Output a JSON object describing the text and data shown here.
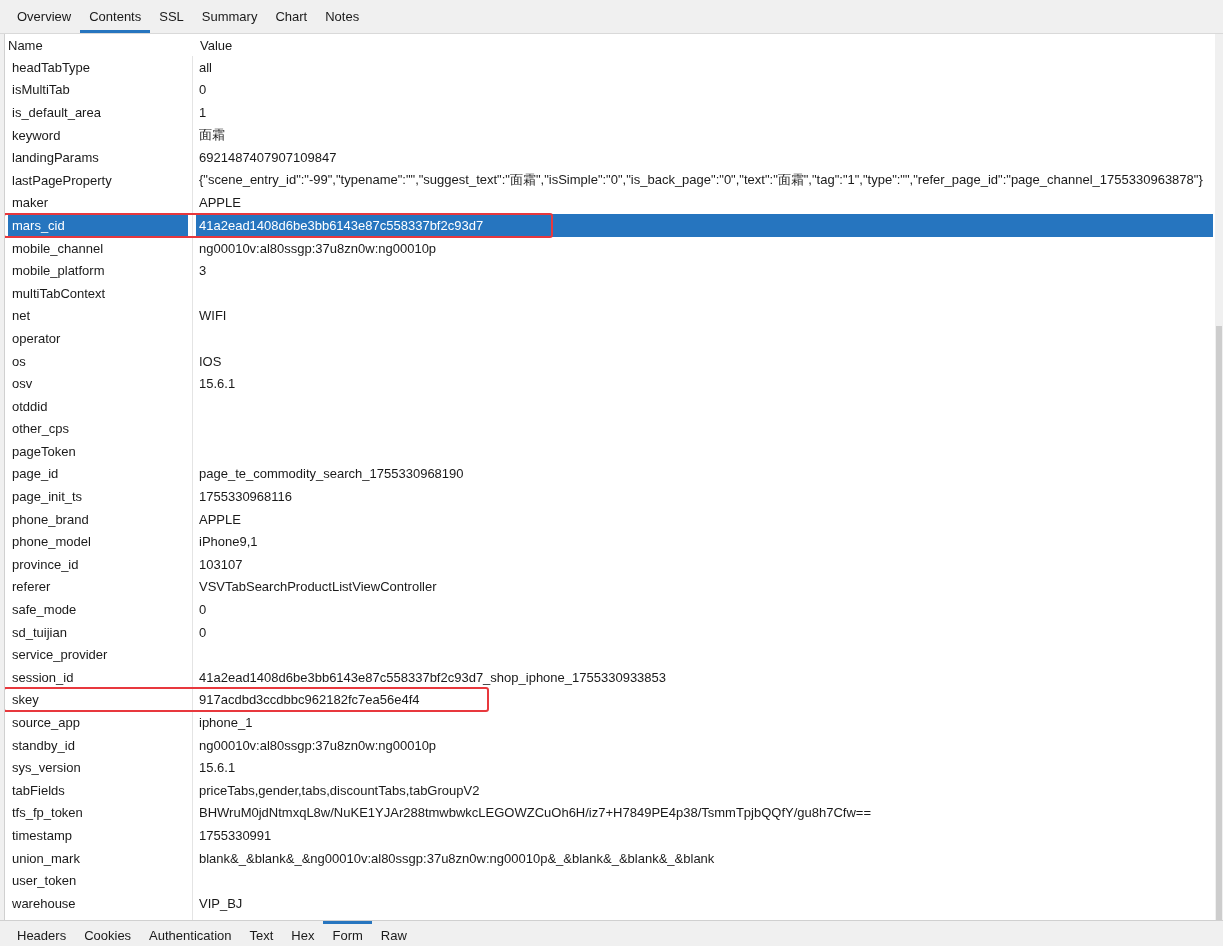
{
  "tabs": [
    {
      "label": "Overview",
      "selected": false
    },
    {
      "label": "Contents",
      "selected": true
    },
    {
      "label": "SSL",
      "selected": false
    },
    {
      "label": "Summary",
      "selected": false
    },
    {
      "label": "Chart",
      "selected": false
    },
    {
      "label": "Notes",
      "selected": false
    }
  ],
  "table": {
    "columns": [
      "Name",
      "Value"
    ],
    "rows": [
      {
        "name": "headTabType",
        "value": "all",
        "selected": false,
        "highlighted": false
      },
      {
        "name": "isMultiTab",
        "value": "0",
        "selected": false,
        "highlighted": false
      },
      {
        "name": "is_default_area",
        "value": "1",
        "selected": false,
        "highlighted": false
      },
      {
        "name": "keyword",
        "value": "面霜",
        "selected": false,
        "highlighted": false
      },
      {
        "name": "landingParams",
        "value": "6921487407907109847",
        "selected": false,
        "highlighted": false
      },
      {
        "name": "lastPageProperty",
        "value": "{\"scene_entry_id\":\"-99\",\"typename\":\"\",\"suggest_text\":\"面霜\",\"isSimple\":\"0\",\"is_back_page\":\"0\",\"text\":\"面霜\",\"tag\":\"1\",\"type\":\"\",\"refer_page_id\":\"page_channel_1755330963878\"}",
        "selected": false,
        "highlighted": false
      },
      {
        "name": "maker",
        "value": "APPLE",
        "selected": false,
        "highlighted": false
      },
      {
        "name": "mars_cid",
        "value": "41a2ead1408d6be3bb6143e87c558337bf2c93d7",
        "selected": true,
        "highlighted": true
      },
      {
        "name": "mobile_channel",
        "value": "ng00010v:al80ssgp:37u8zn0w:ng00010p",
        "selected": false,
        "highlighted": false
      },
      {
        "name": "mobile_platform",
        "value": "3",
        "selected": false,
        "highlighted": false
      },
      {
        "name": "multiTabContext",
        "selected": false,
        "highlighted": false
      },
      {
        "name": "net",
        "value": "WIFI",
        "selected": false,
        "highlighted": false
      },
      {
        "name": "operator",
        "selected": false,
        "highlighted": false
      },
      {
        "name": "os",
        "value": "IOS",
        "selected": false,
        "highlighted": false
      },
      {
        "name": "osv",
        "value": "15.6.1",
        "selected": false,
        "highlighted": false
      },
      {
        "name": "otddid",
        "selected": false,
        "highlighted": false
      },
      {
        "name": "other_cps",
        "selected": false,
        "highlighted": false
      },
      {
        "name": "pageToken",
        "selected": false,
        "highlighted": false
      },
      {
        "name": "page_id",
        "value": "page_te_commodity_search_1755330968190",
        "selected": false,
        "highlighted": false
      },
      {
        "name": "page_init_ts",
        "value": "1755330968116",
        "selected": false,
        "highlighted": false
      },
      {
        "name": "phone_brand",
        "value": "APPLE",
        "selected": false,
        "highlighted": false
      },
      {
        "name": "phone_model",
        "value": "iPhone9,1",
        "selected": false,
        "highlighted": false
      },
      {
        "name": "province_id",
        "value": "103107",
        "selected": false,
        "highlighted": false
      },
      {
        "name": "referer",
        "value": "VSVTabSearchProductListViewController",
        "selected": false,
        "highlighted": false
      },
      {
        "name": "safe_mode",
        "value": "0",
        "selected": false,
        "highlighted": false
      },
      {
        "name": "sd_tuijian",
        "value": "0",
        "selected": false,
        "highlighted": false
      },
      {
        "name": "service_provider",
        "selected": false,
        "highlighted": false
      },
      {
        "name": "session_id",
        "value": "41a2ead1408d6be3bb6143e87c558337bf2c93d7_shop_iphone_1755330933853",
        "selected": false,
        "highlighted": false
      },
      {
        "name": "skey",
        "value": "917acdbd3ccdbbc962182fc7ea56e4f4",
        "selected": false,
        "highlighted": true
      },
      {
        "name": "source_app",
        "value": "iphone_1",
        "selected": false,
        "highlighted": false
      },
      {
        "name": "standby_id",
        "value": "ng00010v:al80ssgp:37u8zn0w:ng00010p",
        "selected": false,
        "highlighted": false
      },
      {
        "name": "sys_version",
        "value": "15.6.1",
        "selected": false,
        "highlighted": false
      },
      {
        "name": "tabFields",
        "value": "priceTabs,gender,tabs,discountTabs,tabGroupV2",
        "selected": false,
        "highlighted": false
      },
      {
        "name": "tfs_fp_token",
        "value": "BHWruM0jdNtmxqL8w/NuKE1YJAr288tmwbwkcLEGOWZCuOh6H/iz7+H7849PE4p38/TsmmTpjbQQfY/gu8h7Cfw==",
        "selected": false,
        "highlighted": false
      },
      {
        "name": "timestamp",
        "value": "1755330991",
        "selected": false,
        "highlighted": false
      },
      {
        "name": "union_mark",
        "value": "blank&_&blank&_&ng00010v:al80ssgp:37u8zn0w:ng00010p&_&blank&_&blank&_&blank",
        "selected": false,
        "highlighted": false
      },
      {
        "name": "user_token",
        "selected": false,
        "highlighted": false
      },
      {
        "name": "warehouse",
        "value": "VIP_BJ",
        "selected": false,
        "highlighted": false
      }
    ]
  },
  "bottom_tabs": [
    {
      "label": "Headers",
      "selected": false
    },
    {
      "label": "Cookies",
      "selected": false
    },
    {
      "label": "Authentication",
      "selected": false
    },
    {
      "label": "Text",
      "selected": false
    },
    {
      "label": "Hex",
      "selected": false
    },
    {
      "label": "Form",
      "selected": true
    },
    {
      "label": "Raw",
      "selected": false
    }
  ]
}
